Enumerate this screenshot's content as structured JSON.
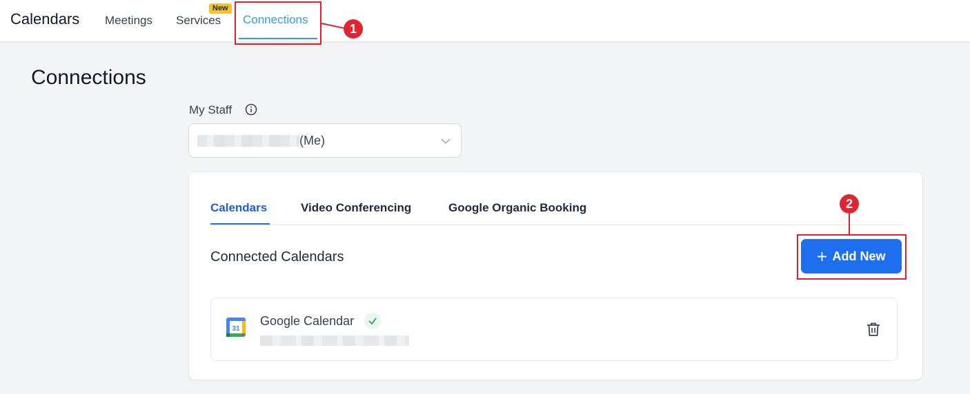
{
  "header": {
    "app_title": "Calendars",
    "tabs": [
      {
        "label": "Meetings"
      },
      {
        "label": "Services",
        "badge": "New"
      },
      {
        "label": "Connections",
        "active": true
      }
    ]
  },
  "annotations": [
    "1",
    "2"
  ],
  "page": {
    "title": "Connections",
    "staff_label": "My Staff",
    "staff_value": "(Me)"
  },
  "card": {
    "tabs": [
      {
        "label": "Calendars",
        "active": true
      },
      {
        "label": "Video Conferencing"
      },
      {
        "label": "Google Organic Booking"
      }
    ],
    "section_title": "Connected Calendars",
    "add_button_label": "Add New",
    "connections": [
      {
        "name": "Google Calendar",
        "icon_day": "31",
        "status": "connected"
      }
    ]
  },
  "colors": {
    "accent": "#2b9fd9",
    "primary_button": "#1e6ff0",
    "annotation": "#e11d2e",
    "badge": "#f7c12b"
  }
}
